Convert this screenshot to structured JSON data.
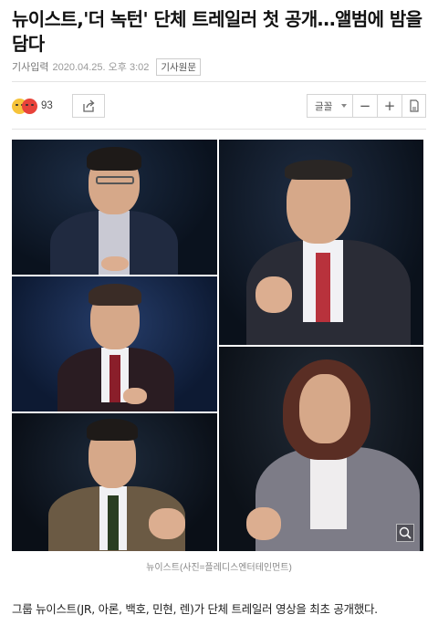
{
  "article": {
    "headline": "뉴이스트,'더 녹턴' 단체 트레일러 첫 공개…앨범에 밤을 담다",
    "publish_label": "기사입력",
    "timestamp": "2020.04.25. 오후 3:02",
    "original_button": "기사원문",
    "reaction_count": "93",
    "font_label": "글꼴",
    "font_minus": "−",
    "font_plus": "+",
    "photo_caption": "뉴이스트(사진=플레디스엔터테인먼트)",
    "body": "그룹 뉴이스트(JR, 아론, 백호, 민현, 렌)가 단체 트레일러 영상을 최초 공개했다."
  },
  "icons": {
    "reaction": "reaction-emoji-icon",
    "share": "share-icon",
    "print": "print-icon",
    "zoom": "zoom-icon"
  },
  "colors": {
    "text": "#111111",
    "meta": "#777777",
    "border": "#d4d4d4"
  }
}
